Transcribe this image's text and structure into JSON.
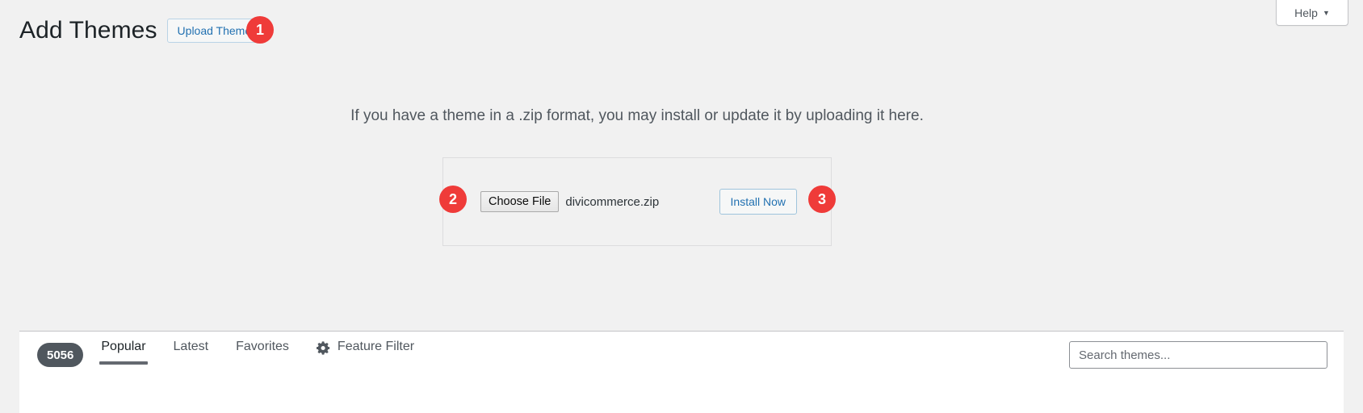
{
  "help": {
    "label": "Help",
    "caret": "▼",
    "icon": "chevron-down-icon"
  },
  "header": {
    "title": "Add Themes",
    "upload_theme_label": "Upload Theme"
  },
  "badges": {
    "one": "1",
    "two": "2",
    "three": "3",
    "color": "#ef3b39"
  },
  "upload": {
    "instructions": "If you have a theme in a .zip format, you may install or update it by uploading it here.",
    "choose_file_label": "Choose File",
    "file_name": "divicommerce.zip",
    "install_now_label": "Install Now"
  },
  "filter_bar": {
    "theme_count": "5056",
    "links": [
      {
        "label": "Popular",
        "active": true
      },
      {
        "label": "Latest",
        "active": false
      },
      {
        "label": "Favorites",
        "active": false
      }
    ],
    "feature_filter_label": "Feature Filter",
    "feature_filter_icon": "gear-icon",
    "search_placeholder": "Search themes..."
  },
  "colors": {
    "page_background": "#f1f1f1",
    "link_blue": "#2271b1",
    "badge_red": "#ef3b39",
    "pill_gray": "#50575e"
  }
}
